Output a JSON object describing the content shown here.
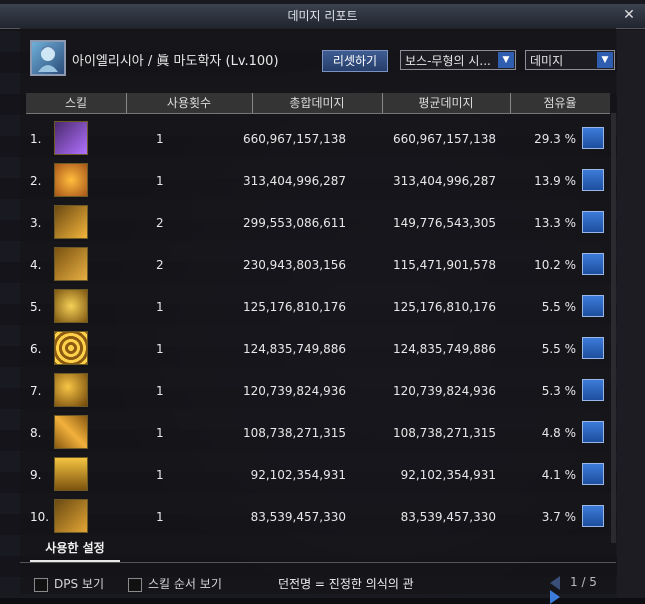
{
  "window": {
    "title": "데미지 리포트"
  },
  "character": {
    "name": "아이엘리시아 / 眞 마도학자 (Lv.100)"
  },
  "controls": {
    "reset_label": "리셋하기",
    "target_select": "보스-무형의 시...",
    "metric_select": "데미지"
  },
  "table": {
    "headers": [
      "스킬",
      "사용횟수",
      "총합데미지",
      "평균데미지",
      "점유율"
    ],
    "rows": [
      {
        "rank": "1.",
        "uses": "1",
        "total": "660,967,157,138",
        "avg": "660,967,157,138",
        "share": "29.3 %",
        "icon": "skill-icon-1"
      },
      {
        "rank": "2.",
        "uses": "1",
        "total": "313,404,996,287",
        "avg": "313,404,996,287",
        "share": "13.9 %",
        "icon": "skill-icon-2"
      },
      {
        "rank": "3.",
        "uses": "2",
        "total": "299,553,086,611",
        "avg": "149,776,543,305",
        "share": "13.3 %",
        "icon": "skill-icon-3"
      },
      {
        "rank": "4.",
        "uses": "2",
        "total": "230,943,803,156",
        "avg": "115,471,901,578",
        "share": "10.2 %",
        "icon": "skill-icon-4"
      },
      {
        "rank": "5.",
        "uses": "1",
        "total": "125,176,810,176",
        "avg": "125,176,810,176",
        "share": "5.5 %",
        "icon": "skill-icon-5"
      },
      {
        "rank": "6.",
        "uses": "1",
        "total": "124,835,749,886",
        "avg": "124,835,749,886",
        "share": "5.5 %",
        "icon": "skill-icon-6"
      },
      {
        "rank": "7.",
        "uses": "1",
        "total": "120,739,824,936",
        "avg": "120,739,824,936",
        "share": "5.3 %",
        "icon": "skill-icon-7"
      },
      {
        "rank": "8.",
        "uses": "1",
        "total": "108,738,271,315",
        "avg": "108,738,271,315",
        "share": "4.8 %",
        "icon": "skill-icon-8"
      },
      {
        "rank": "9.",
        "uses": "1",
        "total": "92,102,354,931",
        "avg": "92,102,354,931",
        "share": "4.1 %",
        "icon": "skill-icon-9"
      },
      {
        "rank": "10.",
        "uses": "1",
        "total": "83,539,457,330",
        "avg": "83,539,457,330",
        "share": "3.7 %",
        "icon": "skill-icon-10"
      }
    ]
  },
  "tabs": {
    "used_settings": "사용한 설정"
  },
  "footer": {
    "dps_label": "DPS 보기",
    "skill_order_label": "스킬 순서 보기",
    "dungeon_label": "던전명 = 진정한 의식의 관",
    "page": "1 / 5"
  },
  "colors": {
    "accent": "#2f5db0",
    "header_bg": "#373737"
  }
}
